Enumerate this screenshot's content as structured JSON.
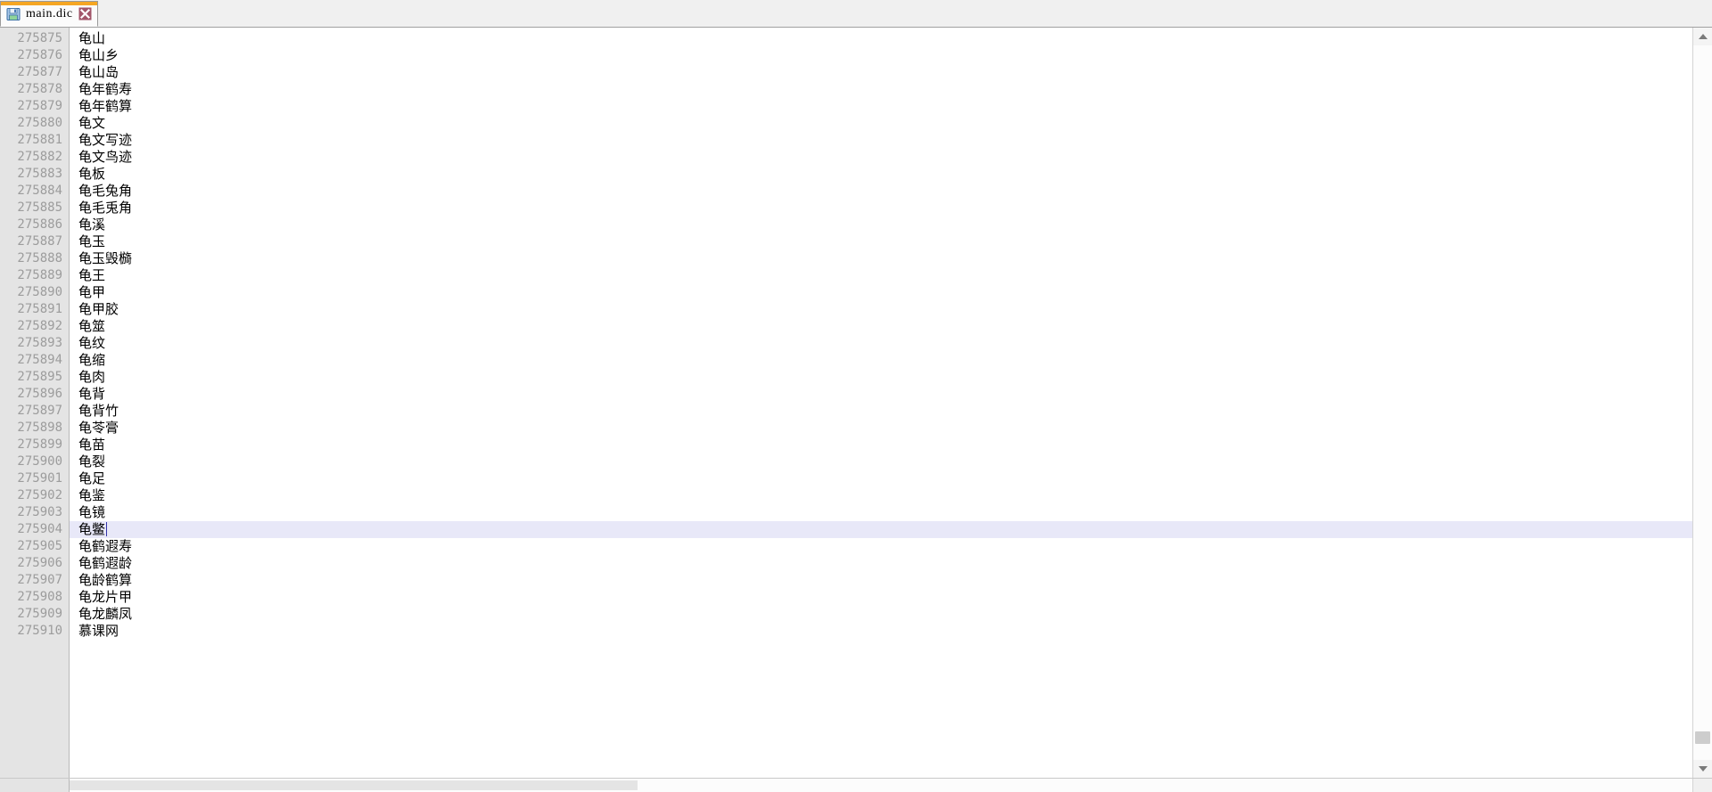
{
  "tab": {
    "label": "main.dic",
    "save_icon": "floppy-disk-icon",
    "close_icon": "close-x-icon",
    "accent_color": "#f5a623",
    "close_color": "#a2566a"
  },
  "editor": {
    "gutter_background": "#e4e4e4",
    "gutter_text_color": "#9c9c9c",
    "current_line_background": "#e8e8f8",
    "caret_color": "#3333aa",
    "current_line_number": 275904,
    "lines": [
      {
        "number": "275875",
        "text": "龟山"
      },
      {
        "number": "275876",
        "text": "龟山乡"
      },
      {
        "number": "275877",
        "text": "龟山岛"
      },
      {
        "number": "275878",
        "text": "龟年鹤寿"
      },
      {
        "number": "275879",
        "text": "龟年鹤算"
      },
      {
        "number": "275880",
        "text": "龟文"
      },
      {
        "number": "275881",
        "text": "龟文写迹"
      },
      {
        "number": "275882",
        "text": "龟文鸟迹"
      },
      {
        "number": "275883",
        "text": "龟板"
      },
      {
        "number": "275884",
        "text": "龟毛兔角"
      },
      {
        "number": "275885",
        "text": "龟毛兎角"
      },
      {
        "number": "275886",
        "text": "龟溪"
      },
      {
        "number": "275887",
        "text": "龟玉"
      },
      {
        "number": "275888",
        "text": "龟玉毁檹"
      },
      {
        "number": "275889",
        "text": "龟王"
      },
      {
        "number": "275890",
        "text": "龟甲"
      },
      {
        "number": "275891",
        "text": "龟甲胶"
      },
      {
        "number": "275892",
        "text": "龟筮"
      },
      {
        "number": "275893",
        "text": "龟纹"
      },
      {
        "number": "275894",
        "text": "龟缩"
      },
      {
        "number": "275895",
        "text": "龟肉"
      },
      {
        "number": "275896",
        "text": "龟背"
      },
      {
        "number": "275897",
        "text": "龟背竹"
      },
      {
        "number": "275898",
        "text": "龟苓膏"
      },
      {
        "number": "275899",
        "text": "龟苗"
      },
      {
        "number": "275900",
        "text": "龟裂"
      },
      {
        "number": "275901",
        "text": "龟足"
      },
      {
        "number": "275902",
        "text": "龟鉴"
      },
      {
        "number": "275903",
        "text": "龟镜"
      },
      {
        "number": "275904",
        "text": "龟鳖"
      },
      {
        "number": "275905",
        "text": "龟鹤遐寿"
      },
      {
        "number": "275906",
        "text": "龟鹤遐龄"
      },
      {
        "number": "275907",
        "text": "龟龄鹤算"
      },
      {
        "number": "275908",
        "text": "龟龙片甲"
      },
      {
        "number": "275909",
        "text": "龟龙麟凤"
      },
      {
        "number": "275910",
        "text": "慕课网"
      }
    ]
  },
  "scrollbars": {
    "vertical_up_icon": "arrow-up-icon",
    "vertical_down_icon": "arrow-down-icon"
  }
}
